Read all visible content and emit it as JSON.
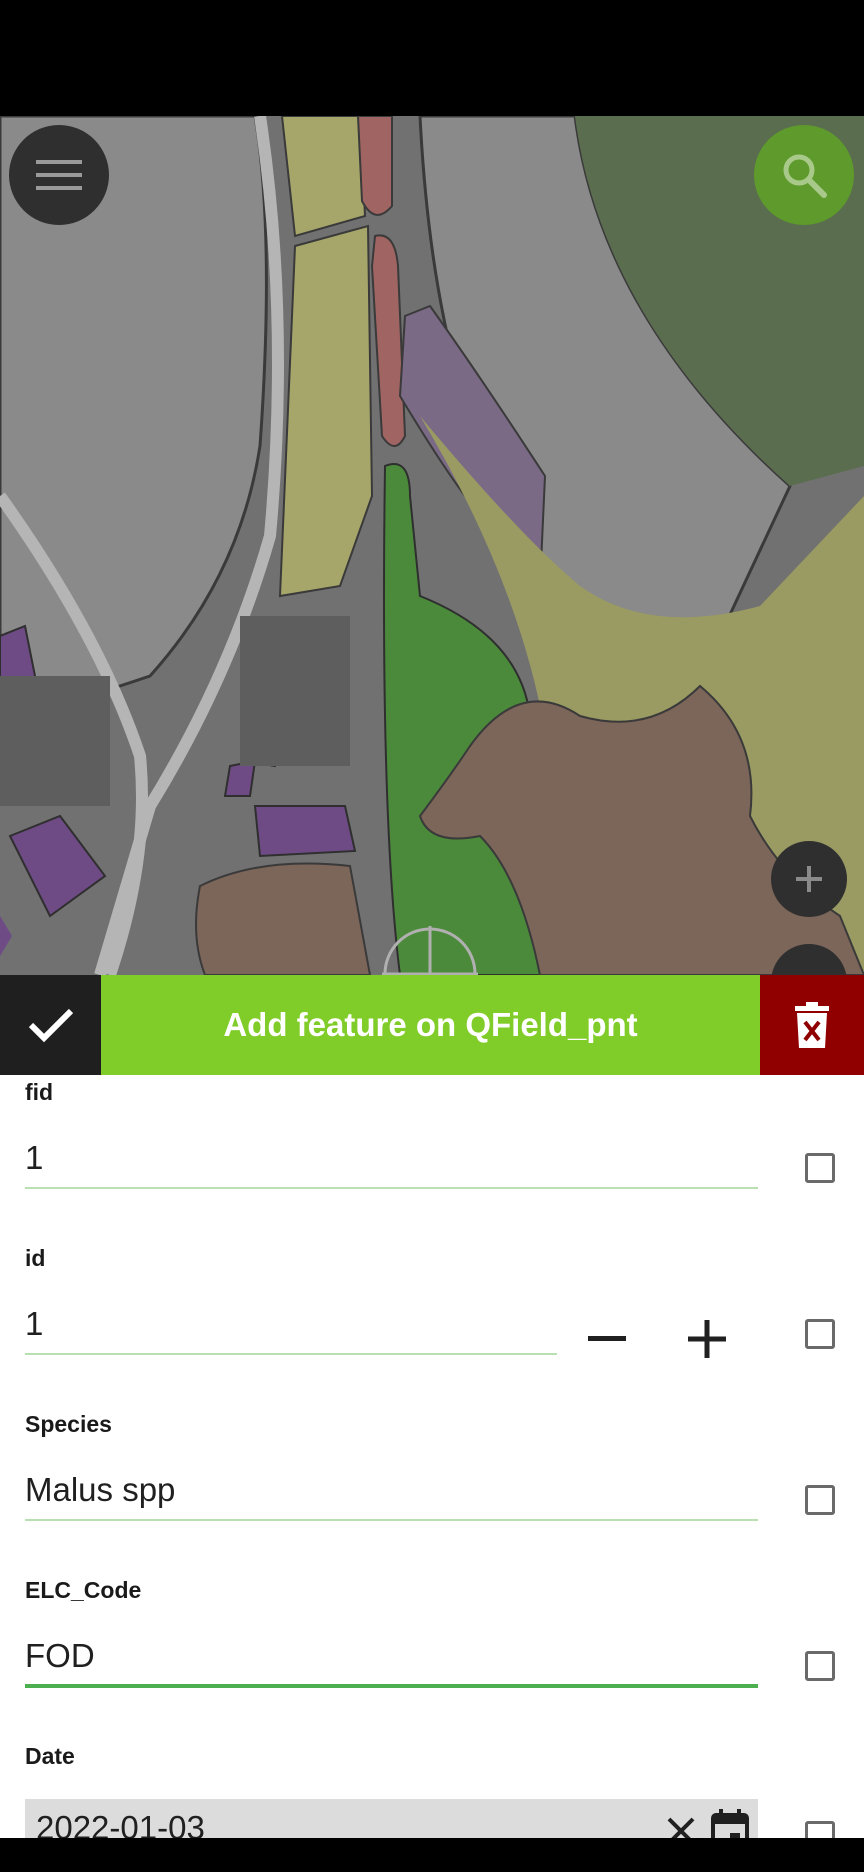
{
  "toolbar": {
    "title": "Add feature on QField_pnt"
  },
  "form": {
    "fields": [
      {
        "label": "fid",
        "value": "1"
      },
      {
        "label": "id",
        "value": "1"
      },
      {
        "label": "Species",
        "value": "Malus spp"
      },
      {
        "label": "ELC_Code",
        "value": "FOD"
      },
      {
        "label": "Date",
        "value": "2022-01-03"
      }
    ]
  },
  "colors": {
    "accent": "#80cc28",
    "delete": "#900000",
    "toolbar_dark": "#1f1f1f",
    "search_button": "#5e9a2c",
    "field_underline_active": "#4caf50"
  },
  "icons": {
    "menu": "menu-icon",
    "search": "search-icon",
    "zoom_in": "plus-icon",
    "save": "check-icon",
    "delete": "trash-icon",
    "decrement": "minus-icon",
    "increment": "plus-icon",
    "clear": "close-icon",
    "calendar": "calendar-icon"
  }
}
